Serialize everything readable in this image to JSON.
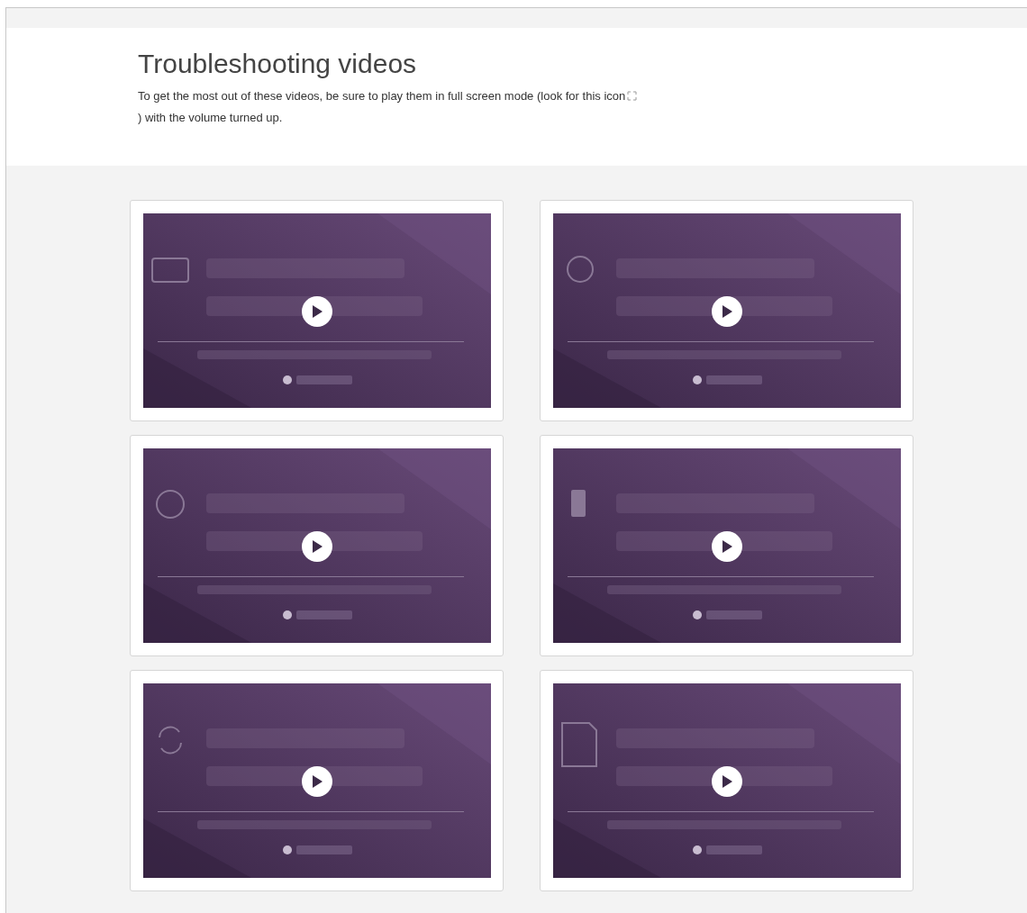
{
  "header": {
    "title": "Troubleshooting videos",
    "intro_before": "To get the most out of these videos, be sure to play them in full screen mode (look for this icon",
    "intro_after": ") with the volume turned up."
  }
}
